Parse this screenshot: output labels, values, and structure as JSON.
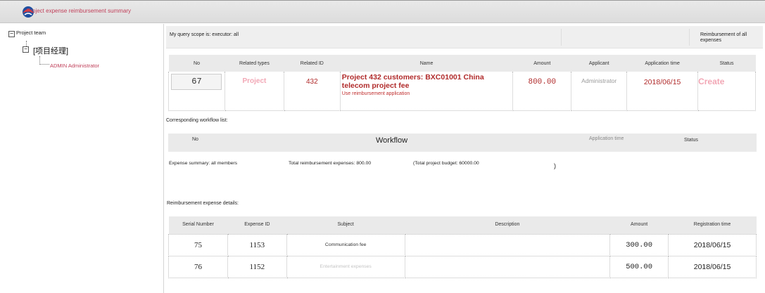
{
  "header": {
    "title": "Project expense reimbursement summary"
  },
  "tree": {
    "root_toggle": "−",
    "root_label": "Project team",
    "child_toggle": "−",
    "child_label": "[项目经理]",
    "leaf_label": "ADMIN Administrator"
  },
  "scope": {
    "text": "My query scope is: executor: all",
    "all_expenses_link": "Reimbursement of all expenses"
  },
  "application": {
    "columns": [
      "No",
      "Related types",
      "Related ID",
      "Name",
      "Amount",
      "Applicant",
      "Application time",
      "Status"
    ],
    "row": {
      "no": "67",
      "type": "Project",
      "related_id": "432",
      "name": "Project 432 customers: BXC01001 China telecom project fee",
      "name_link": "Use reimbursement application",
      "amount": "800.00",
      "applicant": "Administrator",
      "time": "2018/06/15",
      "status": "Create"
    }
  },
  "workflow": {
    "caption": "Corresponding workflow list:",
    "columns": {
      "no": "No",
      "title": "Workflow",
      "time": "Application time",
      "status": "Status"
    }
  },
  "summary": {
    "scope": "Expense summary: all members",
    "total": "Total reimbursement expenses: 800.00",
    "budget": "(Total project budget: 60000.00",
    "paren": ")"
  },
  "details": {
    "caption": "Reimbursement expense details:",
    "columns": [
      "Serial Number",
      "Expense ID",
      "Subject",
      "Description",
      "Amount",
      "Registration time"
    ],
    "rows": [
      {
        "serial": "75",
        "expense_id": "1153",
        "subject": "Communication fee",
        "description": "",
        "amount": "300.00",
        "time": "2018/06/15"
      },
      {
        "serial": "76",
        "expense_id": "1152",
        "subject": "Entertainment expenses",
        "description": "",
        "amount": "500.00",
        "time": "2018/06/15"
      }
    ]
  },
  "colors": {
    "accent": "#b02a2a",
    "faded_accent": "#f2a7b5",
    "title_pink": "#c0405a",
    "header_gray": "#eaeaea"
  },
  "icons": {
    "logo": "brand-logo-icon",
    "tree_toggle": "minus-box-icon"
  }
}
